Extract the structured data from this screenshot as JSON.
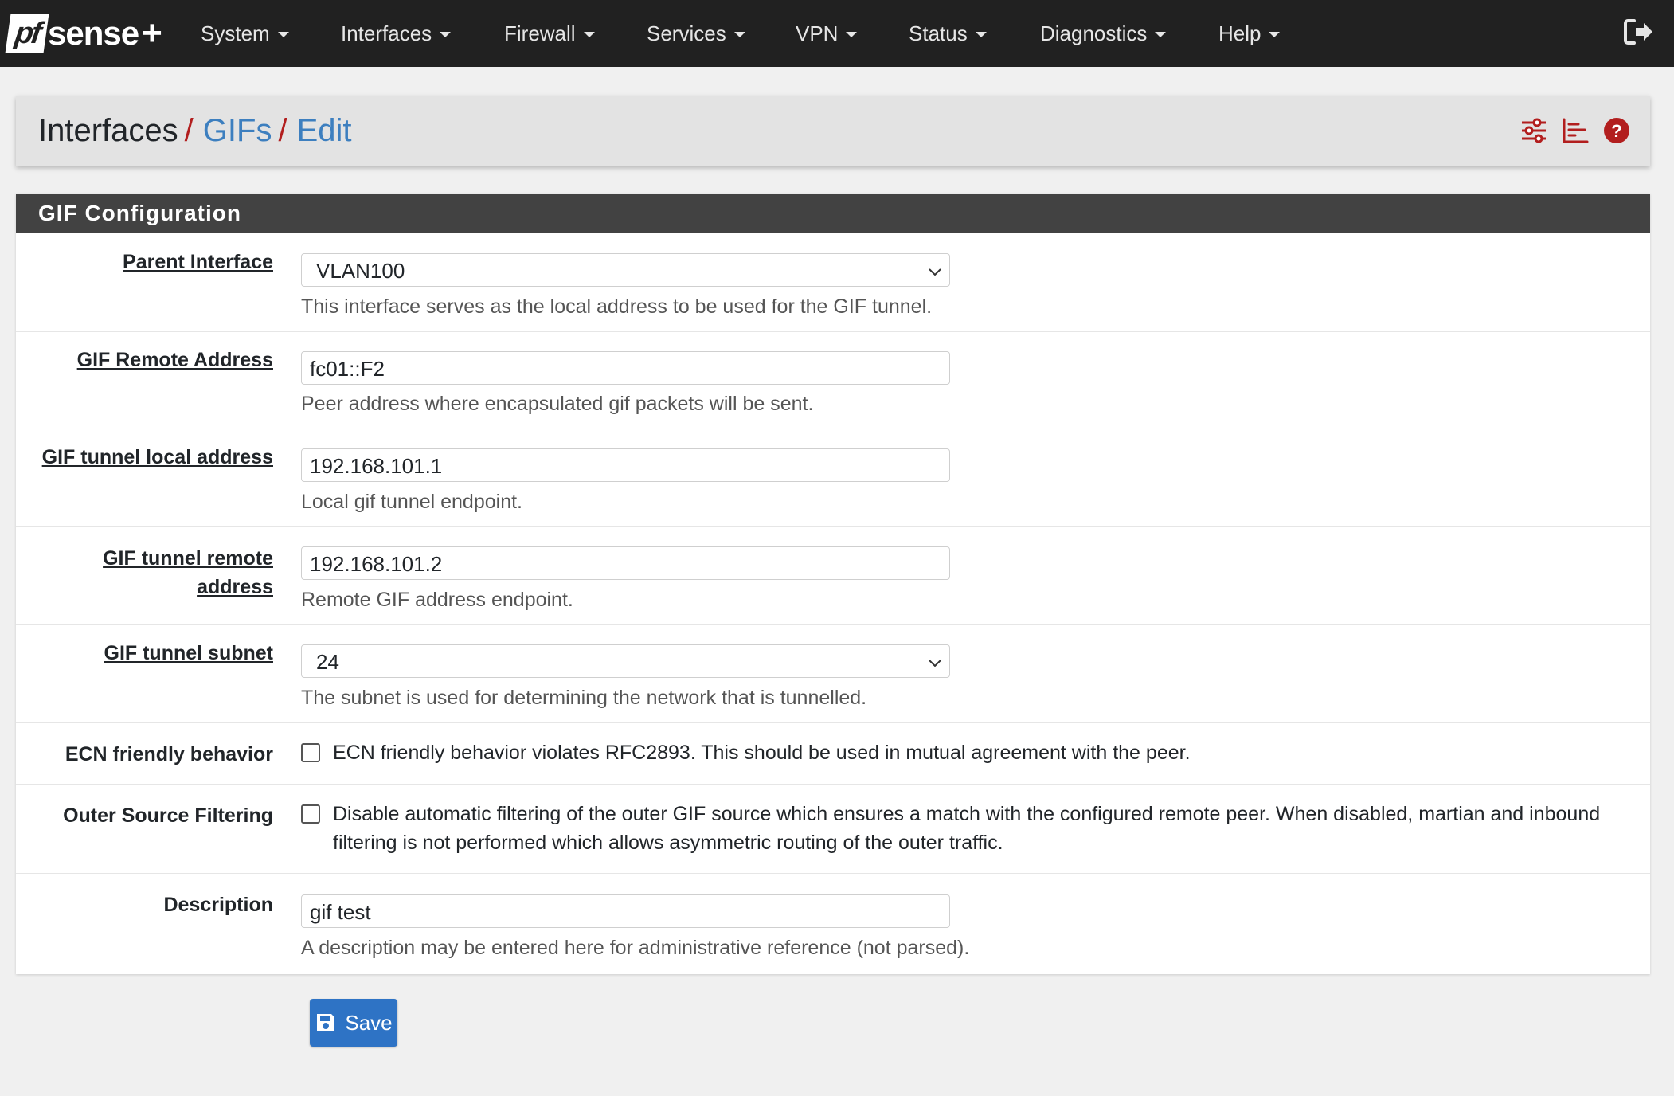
{
  "navbar": {
    "brand_pf": "pf",
    "brand_text": "sense",
    "brand_plus": "+",
    "menu": [
      {
        "label": "System"
      },
      {
        "label": "Interfaces"
      },
      {
        "label": "Firewall"
      },
      {
        "label": "Services"
      },
      {
        "label": "VPN"
      },
      {
        "label": "Status"
      },
      {
        "label": "Diagnostics"
      },
      {
        "label": "Help"
      }
    ],
    "logout_icon": "sign-out-icon"
  },
  "breadcrumb": {
    "items": [
      "Interfaces",
      "GIFs",
      "Edit"
    ],
    "separator": "/",
    "icons": [
      "sliders-icon",
      "chart-icon",
      "help-icon"
    ]
  },
  "panel": {
    "title": "GIF Configuration",
    "fields": {
      "parent_interface": {
        "label": "Parent Interface",
        "value": "VLAN100",
        "help": "This interface serves as the local address to be used for the GIF tunnel."
      },
      "remote_address": {
        "label": "GIF Remote Address",
        "value": "fc01::F2",
        "help": "Peer address where encapsulated gif packets will be sent."
      },
      "tunnel_local": {
        "label": "GIF tunnel local address",
        "value": "192.168.101.1",
        "help": "Local gif tunnel endpoint."
      },
      "tunnel_remote": {
        "label_line1": "GIF tunnel remote",
        "label_line2": "address",
        "value": "192.168.101.2",
        "help": "Remote GIF address endpoint."
      },
      "tunnel_subnet": {
        "label": "GIF tunnel subnet",
        "value": "24",
        "help": "The subnet is used for determining the network that is tunnelled."
      },
      "ecn": {
        "label": "ECN friendly behavior",
        "checked": false,
        "text": "ECN friendly behavior violates RFC2893. This should be used in mutual agreement with the peer."
      },
      "outer_filter": {
        "label": "Outer Source Filtering",
        "checked": false,
        "text": "Disable automatic filtering of the outer GIF source which ensures a match with the configured remote peer. When disabled, martian and inbound filtering is not performed which allows asymmetric routing of the outer traffic."
      },
      "description": {
        "label": "Description",
        "value": "gif test",
        "help": "A description may be entered here for administrative reference (not parsed)."
      }
    }
  },
  "save_button": {
    "label": "Save",
    "icon": "save-icon"
  },
  "colors": {
    "navbar": "#212121",
    "accent_red": "#b21e1e",
    "link_blue": "#3d7fbf",
    "panel_heading": "#424242",
    "button_blue": "#2e73c5"
  }
}
